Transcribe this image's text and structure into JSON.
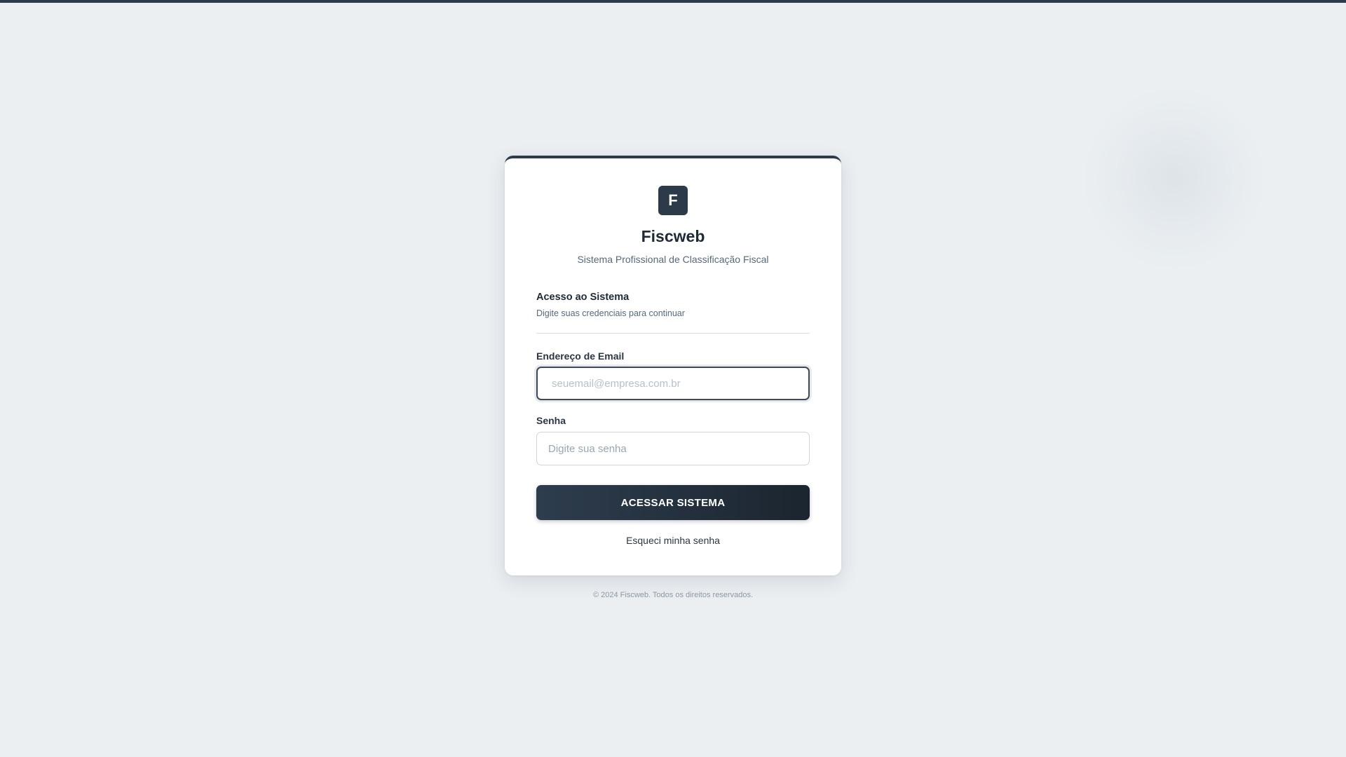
{
  "app": {
    "logo_letter": "F",
    "name": "Fiscweb",
    "tagline": "Sistema Profissional de Classificação Fiscal"
  },
  "login": {
    "title": "Acesso ao Sistema",
    "subtitle": "Digite suas credenciais para continuar",
    "email": {
      "label": "Endereço de Email",
      "placeholder": "seuemail@empresa.com.br",
      "value": ""
    },
    "password": {
      "label": "Senha",
      "placeholder": "Digite sua senha",
      "value": ""
    },
    "submit_label": "ACESSAR SISTEMA",
    "forgot_label": "Esqueci minha senha"
  },
  "footer": {
    "copyright": "© 2024 Fiscweb. Todos os direitos reservados."
  },
  "colors": {
    "page_background": "#ebeff2",
    "primary": "#2c3a4a",
    "text": "#1f2a37",
    "muted_text": "#56697b"
  }
}
